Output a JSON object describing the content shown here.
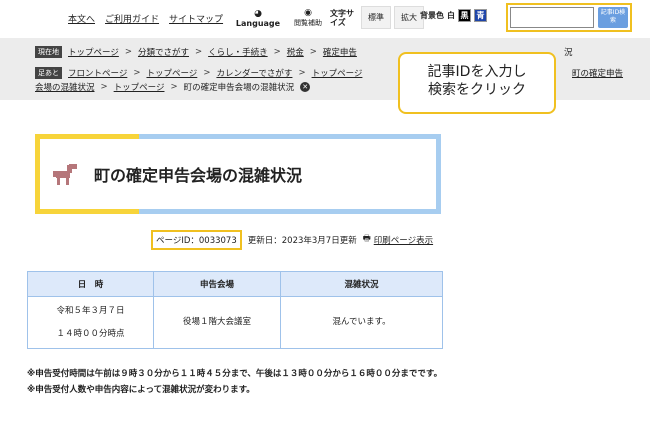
{
  "header": {
    "links": [
      "本文へ",
      "ご利用ガイド",
      "サイトマップ"
    ],
    "language_icon": "globe-icon",
    "language_label": "Language",
    "reading_icon": "eye-icon",
    "reading_label": "閲覧補助",
    "textsize_label": "文字サイズ",
    "textsize_standard": "標準",
    "textsize_large": "拡大",
    "bgcolor_label": "背景色",
    "bg_white": "白",
    "bg_black": "黒",
    "bg_blue": "青",
    "search_input_value": "",
    "search_button": "記事ID検索"
  },
  "breadcrumbs": {
    "current_tag": "現在地",
    "current": [
      "トップページ",
      "分類でさがす",
      "くらし・手続き",
      "税金",
      "確定申告"
    ],
    "current_tail": "況",
    "history_tag": "足あと",
    "history_row1": [
      "フロントページ",
      "トップページ",
      "カレンダーでさがす",
      "トップページ"
    ],
    "history_row1_tail": "町の確定申告",
    "history_row2": [
      "会場の混雑状況",
      "トップページ"
    ],
    "history_row2_tail": "町の確定申告会場の混雑状況"
  },
  "callout": {
    "line1": "記事IDを入力し",
    "line2": "検索をクリック"
  },
  "page": {
    "title": "町の確定申告会場の混雑状況",
    "title_icon": "horse-icon",
    "page_id": "ページID：0033073",
    "updated": "更新日：2023年3月7日更新",
    "print_icon": "printer-icon",
    "print_label": "印刷ページ表示"
  },
  "table": {
    "headers": [
      "日　時",
      "申告会場",
      "混雑状況"
    ],
    "row": {
      "date": "令和５年３月７日",
      "time": "１４時００分時点",
      "venue": "役場１階大会議室",
      "status": "混んでいます。"
    }
  },
  "notes": {
    "line1": "※申告受付時間は午前は９時３０分から１１時４５分まで、午後は１３時００分から１６時００分までです。",
    "line2": "※申告受付人数や申告内容によって混雑状況が変わります。"
  },
  "colors": {
    "accent_yellow": "#f0c020",
    "title_yellow": "#f7d43a",
    "title_blue": "#a7cdf0",
    "table_header": "#dde9fa",
    "search_button": "#6a9ee0"
  }
}
